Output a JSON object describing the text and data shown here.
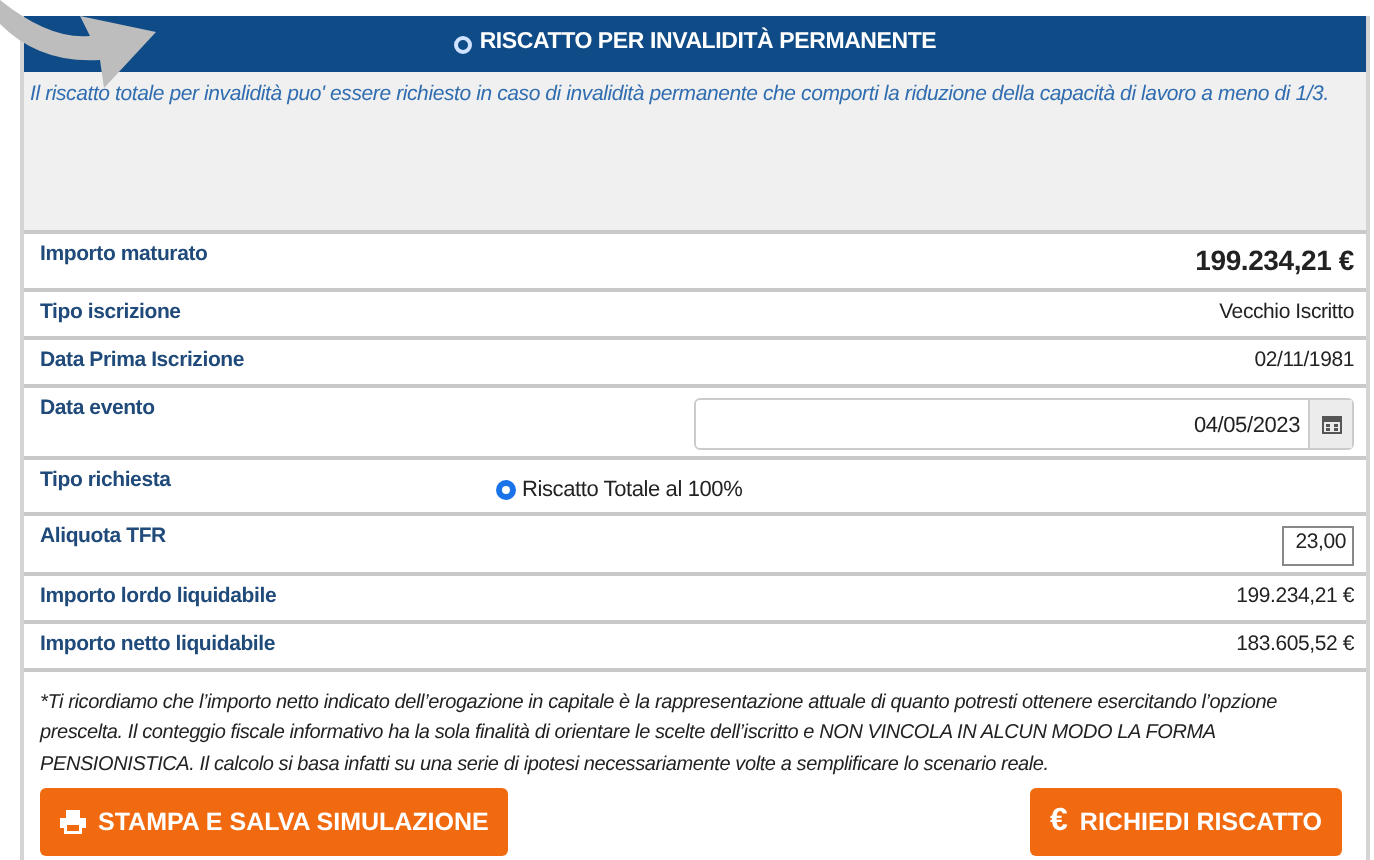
{
  "panel": {
    "title": "RISCATTO PER INVALIDITÀ PERMANENTE",
    "description": "Il riscatto totale per invalidità puo' essere richiesto in caso di invalidità permanente che comporti la riduzione della capacità di lavoro a meno di 1/3."
  },
  "rows": [
    {
      "kind": "amount",
      "label": "Importo maturato",
      "value": "199.234,21 €"
    },
    {
      "kind": "text",
      "label": "Tipo iscrizione",
      "value": "Vecchio Iscritto"
    },
    {
      "kind": "text",
      "label": "Data Prima Iscrizione",
      "value": "02/11/1981"
    },
    {
      "kind": "date",
      "label": "Data evento",
      "value": "04/05/2023"
    },
    {
      "kind": "radio",
      "label": "Tipo richiesta",
      "value": "Riscatto Totale al 100%",
      "selected": true
    },
    {
      "kind": "input",
      "label": "Aliquota TFR",
      "value": "23,00"
    },
    {
      "kind": "text",
      "label": "Importo lordo liquidabile",
      "value": "199.234,21 €"
    },
    {
      "kind": "text",
      "label": "Importo netto liquidabile",
      "value": "183.605,52 €"
    }
  ],
  "note": "*Ti ricordiamo che l’importo netto indicato dell’erogazione in capitale è la rappresentazione attuale di quanto potresti ottenere esercitando l’opzione prescelta. Il conteggio fiscale informativo ha la sola finalità di orientare le scelte dell’iscritto e NON VINCOLA IN ALCUN MODO LA FORMA PENSIONISTICA. Il calcolo si basa infatti su una serie di ipotesi necessariamente volte a semplificare lo scenario reale.",
  "buttons": [
    {
      "kind": "print",
      "label": "STAMPA E SALVA SIMULAZIONE"
    },
    {
      "kind": "glyph",
      "icon": "€",
      "label": "RICHIEDI RISCATTO"
    }
  ]
}
